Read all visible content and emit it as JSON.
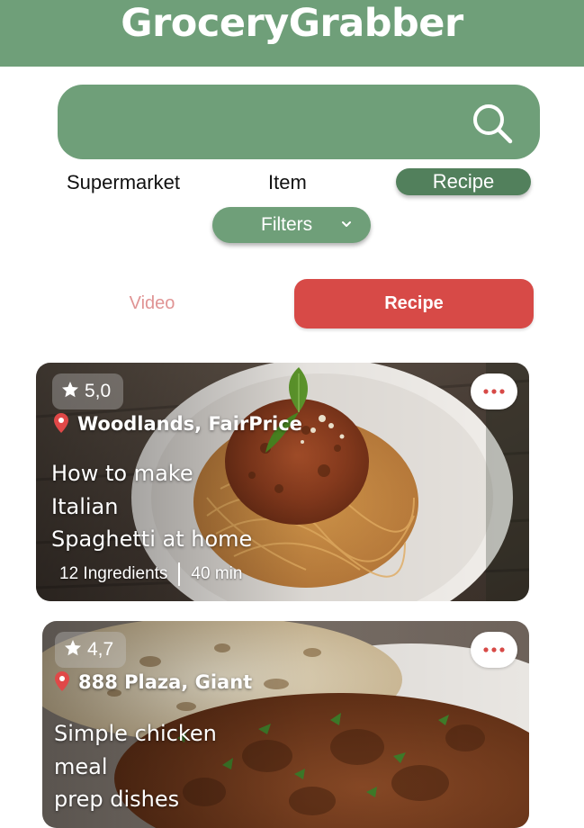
{
  "app": {
    "title": "GroceryGrabber"
  },
  "search": {
    "placeholder": ""
  },
  "category_tabs": [
    {
      "label": "Supermarket",
      "active": false
    },
    {
      "label": "Item",
      "active": false
    },
    {
      "label": "Recipe",
      "active": true
    }
  ],
  "filters": {
    "label": "Filters"
  },
  "content_toggle": [
    {
      "label": "Video",
      "active": false
    },
    {
      "label": "Recipe",
      "active": true
    }
  ],
  "recipes": [
    {
      "rating": "5,0",
      "location": "Woodlands, FairPrice",
      "title_lines": [
        "How to make",
        "Italian",
        "Spaghetti at home"
      ],
      "ingredients": "12 Ingredients",
      "duration": "40 min"
    },
    {
      "rating": "4,7",
      "location": "888 Plaza, Giant",
      "title_lines": [
        "Simple chicken",
        "meal",
        "prep dishes"
      ]
    }
  ],
  "colors": {
    "primary_green": "#6f9f79",
    "active_green": "#52805c",
    "accent_red": "#d74a47",
    "muted_red": "#e09494"
  },
  "icons": [
    "search-icon",
    "chevron-down-icon",
    "star-icon",
    "location-pin-icon",
    "more-icon"
  ]
}
